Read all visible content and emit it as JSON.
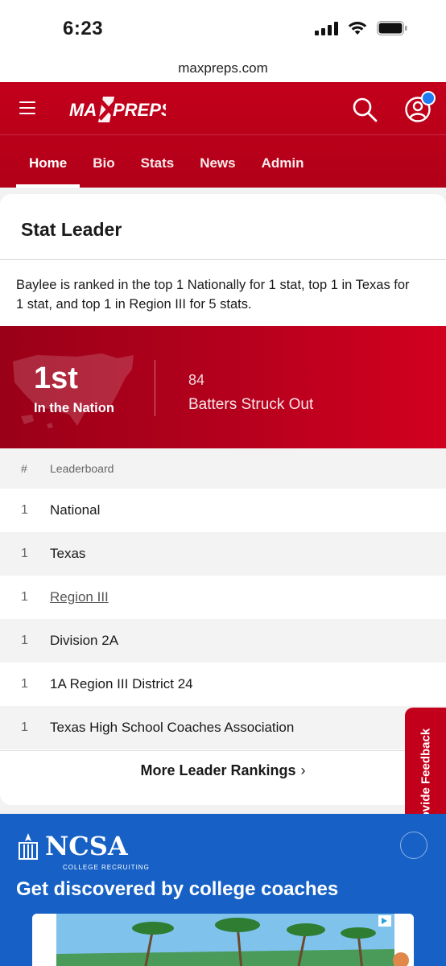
{
  "status_bar": {
    "time": "6:23"
  },
  "browser": {
    "url": "maxpreps.com"
  },
  "header": {
    "logo_text": "MAXPREPS",
    "tabs": [
      {
        "label": "Home",
        "active": true
      },
      {
        "label": "Bio"
      },
      {
        "label": "Stats"
      },
      {
        "label": "News"
      },
      {
        "label": "Admin"
      }
    ]
  },
  "stat_leader": {
    "title": "Stat Leader",
    "description": "Baylee is ranked in the top 1 Nationally for 1 stat, top 1 in Texas for 1 stat, and top 1 in Region III for 5 stats.",
    "highlight": {
      "rank": "1st",
      "rank_label": "In the Nation",
      "stat_value": "84",
      "stat_name": "Batters Struck Out"
    },
    "leaderboard": {
      "col_num": "#",
      "col_name": "Leaderboard",
      "rows": [
        {
          "num": "1",
          "name": "National"
        },
        {
          "num": "1",
          "name": "Texas"
        },
        {
          "num": "1",
          "name": "Region III",
          "link": true
        },
        {
          "num": "1",
          "name": "Division 2A"
        },
        {
          "num": "1",
          "name": "1A Region III District 24"
        },
        {
          "num": "1",
          "name": "Texas High School Coaches Association"
        }
      ]
    },
    "more_link": "More Leader Rankings"
  },
  "feedback": {
    "label": "Provide Feedback"
  },
  "ad": {
    "brand": "NCSA",
    "brand_sub": "COLLEGE RECRUITING",
    "headline": "Get discovered by college coaches"
  },
  "colors": {
    "brand_red": "#c3001b",
    "ad_blue": "#1761c6",
    "notif_blue": "#1e7bf0"
  }
}
